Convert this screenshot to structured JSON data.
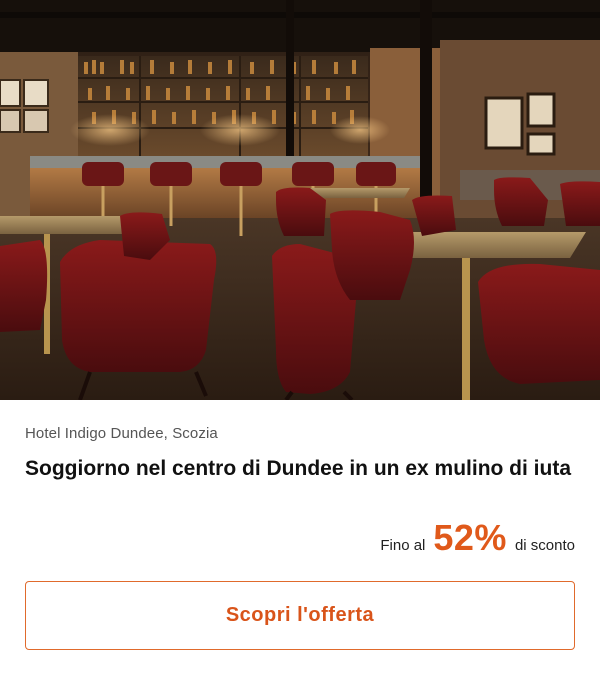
{
  "offer": {
    "hotel_name": "Hotel Indigo Dundee, Scozia",
    "title": "Soggiorno nel centro di Dundee in un ex mulino di iuta",
    "discount": {
      "prefix": "Fino al",
      "value": "52%",
      "suffix": "di sconto"
    },
    "cta_label": "Scopri l'offerta"
  },
  "colors": {
    "accent": "#e0591a",
    "cta_border": "#e06a2c"
  }
}
